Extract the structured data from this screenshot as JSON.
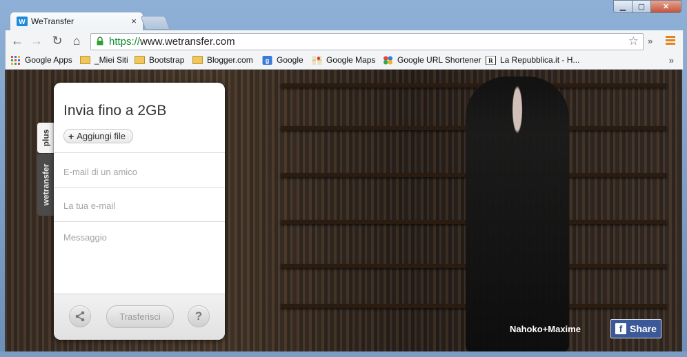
{
  "browser": {
    "tab_title": "WeTransfer",
    "tab_close": "×",
    "url_scheme": "https://",
    "url_rest": "www.wetransfer.com",
    "overflow_chevron": "»",
    "window_buttons": {
      "minimize": "▁",
      "maximize": "▢",
      "close": "✕"
    }
  },
  "bookmarks": {
    "items": [
      {
        "label": "Google Apps",
        "icon": "apps-grid-icon"
      },
      {
        "label": "_Miei Siti",
        "icon": "folder-icon"
      },
      {
        "label": "Bootstrap",
        "icon": "folder-icon"
      },
      {
        "label": "Blogger.com",
        "icon": "folder-icon"
      },
      {
        "label": "Google",
        "icon": "google-icon"
      },
      {
        "label": "Google Maps",
        "icon": "maps-icon"
      },
      {
        "label": "Google URL Shortener",
        "icon": "shortener-icon"
      },
      {
        "label": "La Repubblica.it - H...",
        "icon": "repubblica-icon"
      }
    ],
    "more": "»"
  },
  "sidetabs": {
    "plus": "plus",
    "wetransfer": "wetransfer"
  },
  "panel": {
    "title": "Invia fino a 2GB",
    "add_files": "Aggiungi file",
    "add_plus": "+",
    "friend_email_placeholder": "E-mail di un amico",
    "your_email_placeholder": "La tua e-mail",
    "message_placeholder": "Messaggio",
    "transfer_button": "Trasferisci",
    "help_button": "?"
  },
  "background": {
    "credit": "Nahoko+Maxime",
    "share_label": "Share",
    "share_icon_letter": "f"
  },
  "colors": {
    "facebook": "#3b5998",
    "url_scheme": "#0a8a2a",
    "menu_accent": "#e8821d"
  }
}
